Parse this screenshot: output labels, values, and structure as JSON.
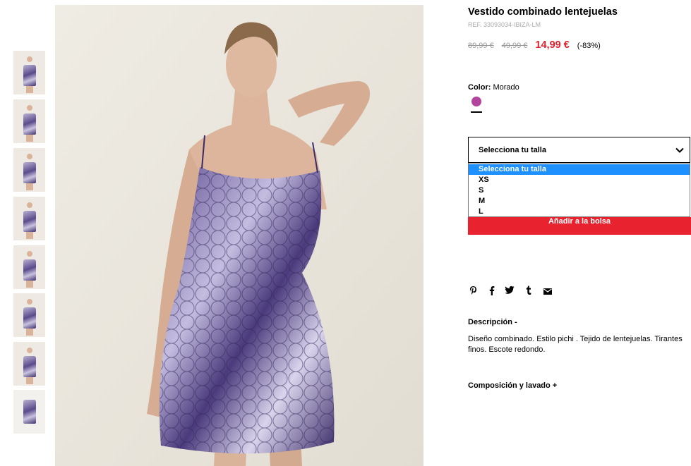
{
  "product": {
    "title": "Vestido combinado lentejuelas",
    "ref": "REF. 33093034-IBIZA-LM",
    "price_original_1": "89,99 €",
    "price_original_2": "49,99 €",
    "price_sale": "14,99 €",
    "discount": "(-83%)"
  },
  "color": {
    "label": "Color:",
    "value": "Morado",
    "swatch_hex": "#b3449e"
  },
  "size_select": {
    "selected": "Selecciona tu talla",
    "options": [
      "Selecciona tu talla",
      "XS",
      "S",
      "M",
      "L"
    ]
  },
  "add_to_bag": "Añadir a la bolsa",
  "share_icons": [
    "pinterest-icon",
    "facebook-icon",
    "twitter-icon",
    "tumblr-icon",
    "email-icon"
  ],
  "description": {
    "heading": "Descripción -",
    "text": "Diseño combinado. Estilo pichi . Tejido de lentejuelas. Tirantes finos. Escote redondo."
  },
  "composition_heading": "Composición y lavado +",
  "thumbnails_count": 8,
  "colors": {
    "sale_red": "#e0222f",
    "button_red": "#e8232f",
    "highlight_blue": "#1e90ff"
  }
}
